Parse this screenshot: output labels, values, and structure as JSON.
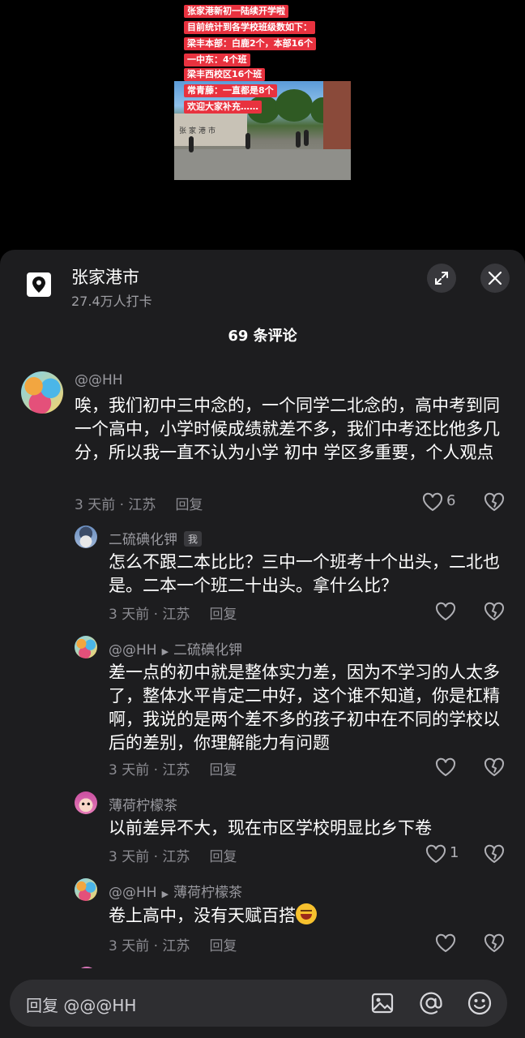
{
  "video": {
    "caption_lines": [
      "张家港新初一陆续开学啦",
      "目前统计到各学校班级数如下：",
      "梁丰本部：白鹿2个，本部16个",
      "一中东：4个班",
      "梁丰西校区16个班",
      "常青藤：一直都是8个",
      "欢迎大家补充……"
    ]
  },
  "location": {
    "name": "张家港市",
    "checkins": "27.4万人打卡"
  },
  "comments_header": {
    "count_label": "69 条评论"
  },
  "comments": [
    {
      "user": "@@HH",
      "text": "唉，我们初中三中念的，一个同学二北念的，高中考到同一个高中，小学时候成绩就差不多，我们中考还比他多几分，所以我一直不认为小学 初中 学区多重要，个人观点",
      "meta": "3 天前 · 江苏",
      "reply_label": "回复",
      "likes": "6"
    },
    {
      "user": "二硫碘化钾",
      "tag": "我",
      "text": "怎么不跟二本比比？三中一个班考十个出头，二北也是。二本一个班二十出头。拿什么比？",
      "meta": "3 天前 · 江苏",
      "reply_label": "回复",
      "likes": ""
    },
    {
      "user": "@@HH",
      "reply_to": "二硫碘化钾",
      "text": "差一点的初中就是整体实力差，因为不学习的人太多了，整体水平肯定二中好，这个谁不知道，你是杠精啊，我说的是两个差不多的孩子初中在不同的学校以后的差别，你理解能力有问题",
      "meta": "3 天前 · 江苏",
      "reply_label": "回复",
      "likes": ""
    },
    {
      "user": "薄荷柠檬茶",
      "text": "以前差异不大，现在市区学校明显比乡下卷",
      "meta": "3 天前 · 江苏",
      "reply_label": "回复",
      "likes": "1"
    },
    {
      "user": "@@HH",
      "reply_to": "薄荷柠檬茶",
      "text": "卷上高中，没有天赋百搭",
      "meta": "3 天前 · 江苏",
      "reply_label": "回复",
      "likes": ""
    }
  ],
  "reply_bar": {
    "placeholder": "回复 @@@HH"
  },
  "icons": {
    "location": "location-pin-icon",
    "expand": "expand-icon",
    "close": "close-icon",
    "like": "heart-outline-icon",
    "dislike": "broken-heart-icon",
    "image": "image-icon",
    "mention": "at-sign-icon",
    "emoji": "emoji-face-icon"
  }
}
